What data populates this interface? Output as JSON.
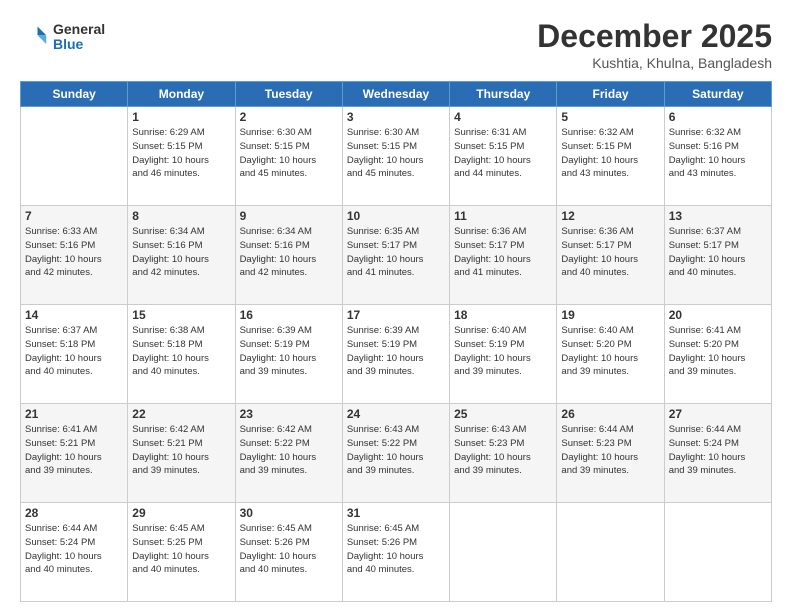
{
  "header": {
    "logo_general": "General",
    "logo_blue": "Blue",
    "month_title": "December 2025",
    "location": "Kushtia, Khulna, Bangladesh"
  },
  "weekdays": [
    "Sunday",
    "Monday",
    "Tuesday",
    "Wednesday",
    "Thursday",
    "Friday",
    "Saturday"
  ],
  "weeks": [
    [
      {
        "day": "",
        "info": ""
      },
      {
        "day": "1",
        "info": "Sunrise: 6:29 AM\nSunset: 5:15 PM\nDaylight: 10 hours\nand 46 minutes."
      },
      {
        "day": "2",
        "info": "Sunrise: 6:30 AM\nSunset: 5:15 PM\nDaylight: 10 hours\nand 45 minutes."
      },
      {
        "day": "3",
        "info": "Sunrise: 6:30 AM\nSunset: 5:15 PM\nDaylight: 10 hours\nand 45 minutes."
      },
      {
        "day": "4",
        "info": "Sunrise: 6:31 AM\nSunset: 5:15 PM\nDaylight: 10 hours\nand 44 minutes."
      },
      {
        "day": "5",
        "info": "Sunrise: 6:32 AM\nSunset: 5:15 PM\nDaylight: 10 hours\nand 43 minutes."
      },
      {
        "day": "6",
        "info": "Sunrise: 6:32 AM\nSunset: 5:16 PM\nDaylight: 10 hours\nand 43 minutes."
      }
    ],
    [
      {
        "day": "7",
        "info": "Sunrise: 6:33 AM\nSunset: 5:16 PM\nDaylight: 10 hours\nand 42 minutes."
      },
      {
        "day": "8",
        "info": "Sunrise: 6:34 AM\nSunset: 5:16 PM\nDaylight: 10 hours\nand 42 minutes."
      },
      {
        "day": "9",
        "info": "Sunrise: 6:34 AM\nSunset: 5:16 PM\nDaylight: 10 hours\nand 42 minutes."
      },
      {
        "day": "10",
        "info": "Sunrise: 6:35 AM\nSunset: 5:17 PM\nDaylight: 10 hours\nand 41 minutes."
      },
      {
        "day": "11",
        "info": "Sunrise: 6:36 AM\nSunset: 5:17 PM\nDaylight: 10 hours\nand 41 minutes."
      },
      {
        "day": "12",
        "info": "Sunrise: 6:36 AM\nSunset: 5:17 PM\nDaylight: 10 hours\nand 40 minutes."
      },
      {
        "day": "13",
        "info": "Sunrise: 6:37 AM\nSunset: 5:17 PM\nDaylight: 10 hours\nand 40 minutes."
      }
    ],
    [
      {
        "day": "14",
        "info": "Sunrise: 6:37 AM\nSunset: 5:18 PM\nDaylight: 10 hours\nand 40 minutes."
      },
      {
        "day": "15",
        "info": "Sunrise: 6:38 AM\nSunset: 5:18 PM\nDaylight: 10 hours\nand 40 minutes."
      },
      {
        "day": "16",
        "info": "Sunrise: 6:39 AM\nSunset: 5:19 PM\nDaylight: 10 hours\nand 39 minutes."
      },
      {
        "day": "17",
        "info": "Sunrise: 6:39 AM\nSunset: 5:19 PM\nDaylight: 10 hours\nand 39 minutes."
      },
      {
        "day": "18",
        "info": "Sunrise: 6:40 AM\nSunset: 5:19 PM\nDaylight: 10 hours\nand 39 minutes."
      },
      {
        "day": "19",
        "info": "Sunrise: 6:40 AM\nSunset: 5:20 PM\nDaylight: 10 hours\nand 39 minutes."
      },
      {
        "day": "20",
        "info": "Sunrise: 6:41 AM\nSunset: 5:20 PM\nDaylight: 10 hours\nand 39 minutes."
      }
    ],
    [
      {
        "day": "21",
        "info": "Sunrise: 6:41 AM\nSunset: 5:21 PM\nDaylight: 10 hours\nand 39 minutes."
      },
      {
        "day": "22",
        "info": "Sunrise: 6:42 AM\nSunset: 5:21 PM\nDaylight: 10 hours\nand 39 minutes."
      },
      {
        "day": "23",
        "info": "Sunrise: 6:42 AM\nSunset: 5:22 PM\nDaylight: 10 hours\nand 39 minutes."
      },
      {
        "day": "24",
        "info": "Sunrise: 6:43 AM\nSunset: 5:22 PM\nDaylight: 10 hours\nand 39 minutes."
      },
      {
        "day": "25",
        "info": "Sunrise: 6:43 AM\nSunset: 5:23 PM\nDaylight: 10 hours\nand 39 minutes."
      },
      {
        "day": "26",
        "info": "Sunrise: 6:44 AM\nSunset: 5:23 PM\nDaylight: 10 hours\nand 39 minutes."
      },
      {
        "day": "27",
        "info": "Sunrise: 6:44 AM\nSunset: 5:24 PM\nDaylight: 10 hours\nand 39 minutes."
      }
    ],
    [
      {
        "day": "28",
        "info": "Sunrise: 6:44 AM\nSunset: 5:24 PM\nDaylight: 10 hours\nand 40 minutes."
      },
      {
        "day": "29",
        "info": "Sunrise: 6:45 AM\nSunset: 5:25 PM\nDaylight: 10 hours\nand 40 minutes."
      },
      {
        "day": "30",
        "info": "Sunrise: 6:45 AM\nSunset: 5:26 PM\nDaylight: 10 hours\nand 40 minutes."
      },
      {
        "day": "31",
        "info": "Sunrise: 6:45 AM\nSunset: 5:26 PM\nDaylight: 10 hours\nand 40 minutes."
      },
      {
        "day": "",
        "info": ""
      },
      {
        "day": "",
        "info": ""
      },
      {
        "day": "",
        "info": ""
      }
    ]
  ]
}
